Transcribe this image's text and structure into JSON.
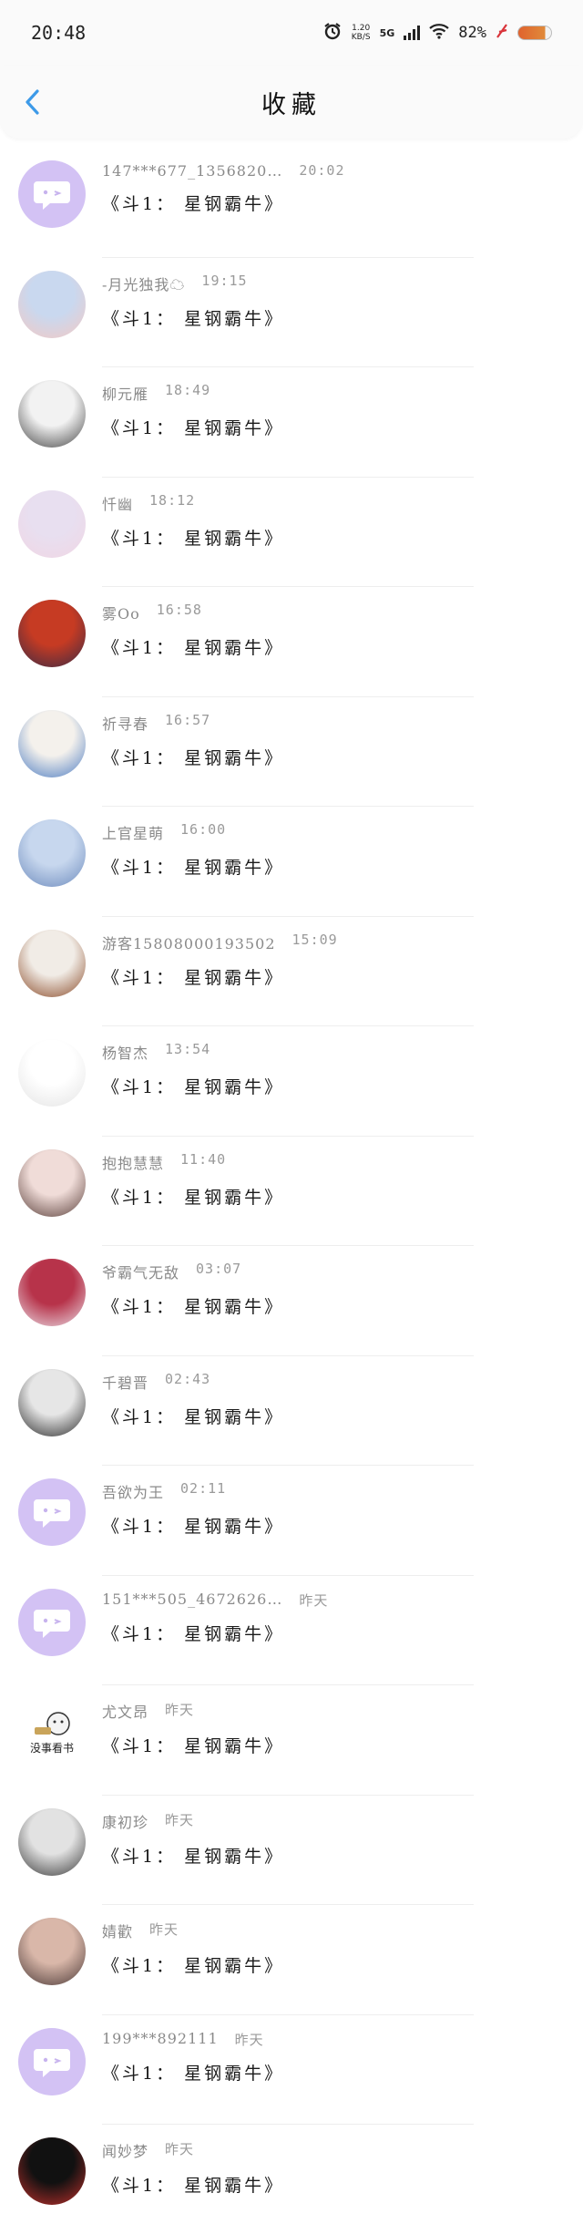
{
  "status": {
    "time": "20:48",
    "net_speed": "1.20",
    "net_unit": "KB/S",
    "network": "5G",
    "battery": "82%"
  },
  "header": {
    "title": "收藏"
  },
  "message_text": "《斗1： 星钢霸牛》",
  "items": [
    {
      "name": "147***677_1356820…",
      "time": "20:02",
      "avatar": "default"
    },
    {
      "name": "-月光独我☁",
      "time": "19:15",
      "avatar": "photo",
      "colors": [
        "#c9d8ef",
        "#f3c9c4"
      ]
    },
    {
      "name": "柳元雁",
      "time": "18:49",
      "avatar": "photo",
      "colors": [
        "#f2f2f2",
        "#444444"
      ]
    },
    {
      "name": "忏幽",
      "time": "18:12",
      "avatar": "photo",
      "colors": [
        "#e8dff0",
        "#f0d6e4"
      ]
    },
    {
      "name": "雾Oo",
      "time": "16:58",
      "avatar": "photo",
      "colors": [
        "#c63b23",
        "#3a2a44"
      ]
    },
    {
      "name": "祈寻春",
      "time": "16:57",
      "avatar": "photo",
      "colors": [
        "#f4f1ec",
        "#4d7cc2"
      ]
    },
    {
      "name": "上官星萌",
      "time": "16:00",
      "avatar": "photo",
      "colors": [
        "#c7d7ee",
        "#6d8bbd"
      ]
    },
    {
      "name": "游客15808000193502",
      "time": "15:09",
      "avatar": "photo",
      "colors": [
        "#f1ece6",
        "#8a4a28"
      ]
    },
    {
      "name": "杨智杰",
      "time": "13:54",
      "avatar": "photo",
      "colors": [
        "#ffffff",
        "#e4e4e4"
      ]
    },
    {
      "name": "抱抱慧慧",
      "time": "11:40",
      "avatar": "photo",
      "colors": [
        "#f0dcd8",
        "#5a3f3a"
      ]
    },
    {
      "name": "爷霸气无敌",
      "time": "03:07",
      "avatar": "photo",
      "colors": [
        "#b7334a",
        "#e9dde5"
      ]
    },
    {
      "name": "千碧晋",
      "time": "02:43",
      "avatar": "photo",
      "colors": [
        "#e6e6e6",
        "#2a2a2a"
      ]
    },
    {
      "name": "吾欲为王",
      "time": "02:11",
      "avatar": "default"
    },
    {
      "name": "151***505_4672626…",
      "time": "昨天",
      "avatar": "default"
    },
    {
      "name": "尤文昂",
      "time": "昨天",
      "avatar": "sticker",
      "caption": "没事看书"
    },
    {
      "name": "康初珍",
      "time": "昨天",
      "avatar": "photo",
      "colors": [
        "#e2e2e2",
        "#3a3a3a"
      ]
    },
    {
      "name": "婧歡",
      "time": "昨天",
      "avatar": "photo",
      "colors": [
        "#d9b7a9",
        "#4a3836"
      ]
    },
    {
      "name": "199***892111",
      "time": "昨天",
      "avatar": "default"
    },
    {
      "name": "闻妙梦",
      "time": "昨天",
      "avatar": "photo",
      "colors": [
        "#111111",
        "#c0302c"
      ]
    }
  ]
}
